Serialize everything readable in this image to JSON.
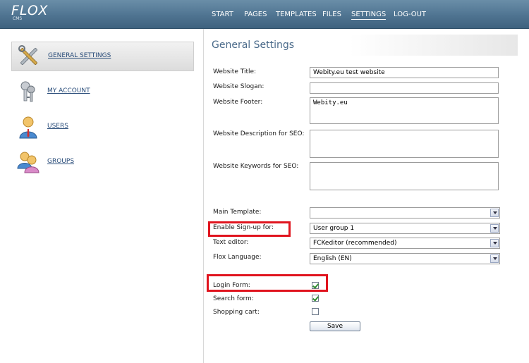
{
  "app": {
    "logo": "FLOX",
    "logo_sub": "CMS"
  },
  "nav": {
    "items": [
      {
        "label": "START"
      },
      {
        "label": "PAGES"
      },
      {
        "label": "TEMPLATES"
      },
      {
        "label": "FILES"
      },
      {
        "label": "SETTINGS",
        "active": true
      },
      {
        "label": "LOG-OUT"
      }
    ]
  },
  "sidebar": {
    "items": [
      {
        "label": "GENERAL SETTINGS",
        "icon": "tools-icon",
        "active": true
      },
      {
        "label": "MY ACCOUNT",
        "icon": "keys-icon"
      },
      {
        "label": "USERS",
        "icon": "user-icon"
      },
      {
        "label": "GROUPS",
        "icon": "group-icon"
      }
    ]
  },
  "main": {
    "title": "General Settings",
    "fields": {
      "website_title": {
        "label": "Website Title:",
        "value": "Webity.eu test website"
      },
      "website_slogan": {
        "label": "Website Slogan:",
        "value": ""
      },
      "website_footer": {
        "label": "Website Footer:",
        "value": "Webity.eu"
      },
      "seo_description": {
        "label": "Website Description for SEO:",
        "value": ""
      },
      "seo_keywords": {
        "label": "Website Keywords for SEO:",
        "value": ""
      },
      "main_template": {
        "label": "Main Template:",
        "value": ""
      },
      "enable_signup": {
        "label": "Enable Sign-up for:",
        "value": "User group 1"
      },
      "text_editor": {
        "label": "Text editor:",
        "value": "FCKeditor (recommended)"
      },
      "flox_language": {
        "label": "Flox Language:",
        "value": "English (EN)"
      }
    },
    "checkboxes": {
      "login_form": {
        "label": "Login Form:",
        "checked": true
      },
      "search_form": {
        "label": "Search form:",
        "checked": true
      },
      "shopping_cart": {
        "label": "Shopping cart:",
        "checked": false
      }
    },
    "save_label": "Save"
  },
  "colors": {
    "header": "#4f7491",
    "link": "#2a4d7a",
    "highlight": "#e0141e",
    "check": "#2e8b2e"
  }
}
